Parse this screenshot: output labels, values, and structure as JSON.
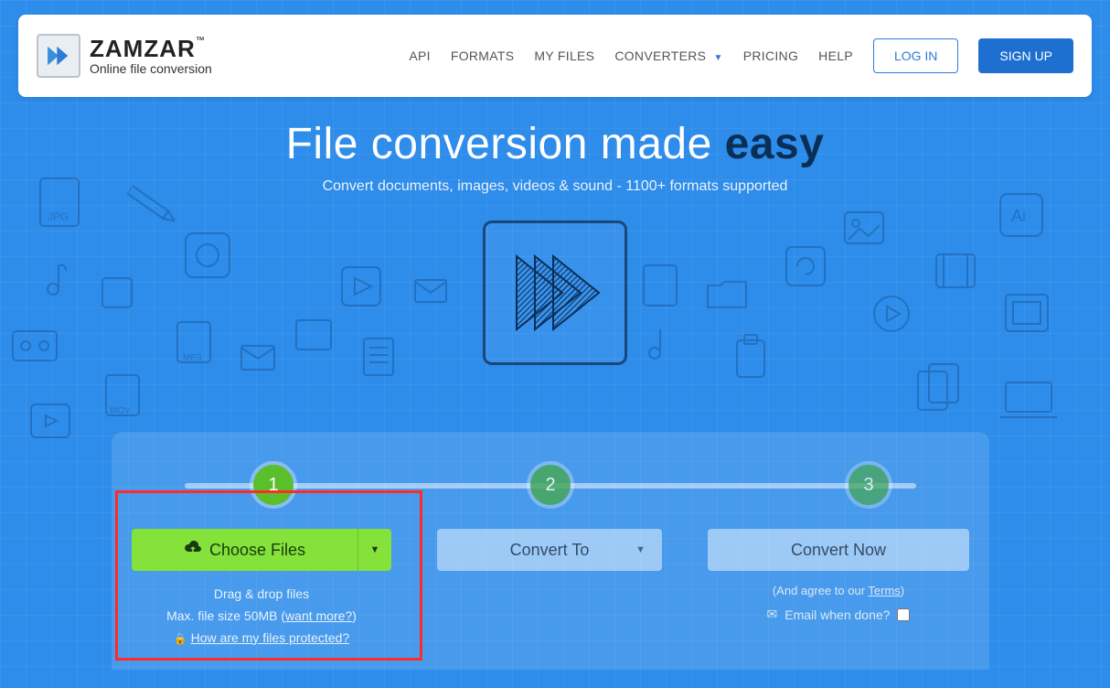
{
  "brand": {
    "name": "ZAMZAR",
    "tm": "™",
    "tagline": "Online file conversion"
  },
  "nav": {
    "api": "API",
    "formats": "FORMATS",
    "myfiles": "MY FILES",
    "converters": "CONVERTERS",
    "pricing": "PRICING",
    "help": "HELP",
    "login": "LOG IN",
    "signup": "SIGN UP"
  },
  "hero": {
    "title_prefix": "File conversion made ",
    "title_strong": "easy",
    "subtitle": "Convert documents, images, videos & sound - 1100+ formats supported"
  },
  "steps": {
    "s1": "1",
    "s2": "2",
    "s3": "3",
    "choose_label": "Choose Files",
    "drag_drop": "Drag & drop files",
    "max_size_prefix": "Max. file size 50MB (",
    "want_more": "want more?",
    "max_size_suffix": ")",
    "protected_link": "How are my files protected?",
    "convert_to": "Convert To",
    "convert_now": "Convert Now",
    "terms_prefix": "(And agree to our ",
    "terms_link": "Terms",
    "terms_suffix": ")",
    "email_when_done": "Email when done?"
  }
}
